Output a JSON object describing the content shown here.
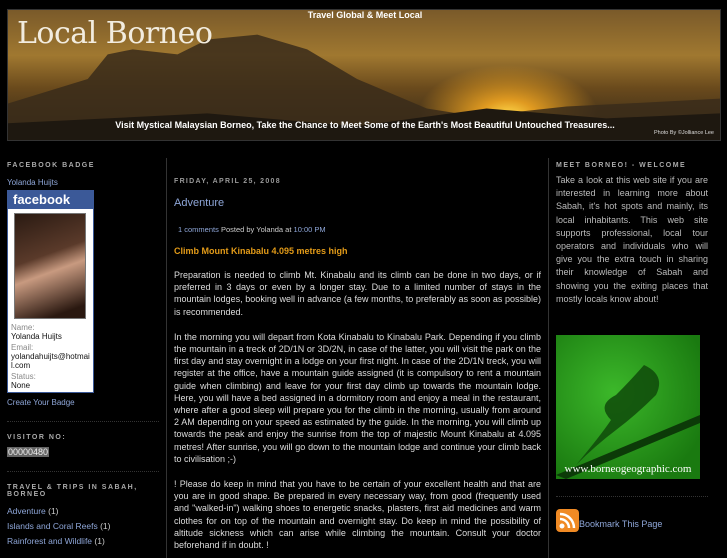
{
  "header": {
    "title": "Local Borneo",
    "tagline": "Travel Global & Meet Local",
    "description": "Visit Mystical Malaysian Borneo, Take the Chance to Meet Some of the Earth's Most Beautiful Untouched Treasures...",
    "photo_credit": "Photo By ©Jolliance Lee"
  },
  "left": {
    "facebook_heading": "Facebook Badge",
    "profile_link": "Yolanda Huijts",
    "badge": {
      "brand": "facebook",
      "name_label": "Name:",
      "name": "Yolanda Huijts",
      "email_label": "Email:",
      "email": "yolandahuijts@hotmail.com",
      "status_label": "Status:",
      "status": "None"
    },
    "create_badge": "Create Your Badge",
    "visitor_heading": "Visitor No:",
    "visitor_count": "00000480",
    "travel_heading": "Travel & Trips in Sabah, Borneo",
    "categories": [
      {
        "label": "Adventure",
        "count": "(1)"
      },
      {
        "label": "Islands and Coral Reefs",
        "count": "(1)"
      },
      {
        "label": "Rainforest and Wildlife",
        "count": "(1)"
      }
    ]
  },
  "post": {
    "date": "Friday, April 25, 2008",
    "title": "Adventure",
    "comments": "1 comments",
    "posted_by": "Posted by Yolanda at",
    "time": "10:00 PM",
    "subtitle": "Climb Mount Kinabalu 4.095 metres high",
    "paragraphs": [
      "Preparation is needed to climb Mt. Kinabalu and its climb can be done in two days, or if preferred in 3 days or even by a longer stay. Due to a limited number of stays in the mountain lodges, booking well in advance (a few months, to preferably as soon as possible) is recommended.",
      "In the morning you will depart from Kota Kinabalu to Kinabalu Park. Depending if you climb the mountain in a treck of 2D/1N or 3D/2N, in case of the latter, you will visit the park on the first day and stay overnight in a lodge on your first night. In case of the 2D/1N treck, you will register at the office, have a mountain guide assigned (it is compulsory to rent a mountain guide when climbing) and leave for your first day climb up towards the mountain lodge. Here, you will have a bed assigned in a dormitory room and enjoy a meal in the restaurant, where after a good sleep will prepare you for the climb in the morning, usually from around 2 AM depending on your speed as estimated by the guide. In the morning, you will climb up towards the peak and enjoy the sunrise from the top of majestic Mount Kinabalu at 4.095 metres! After sunrise, you will go down to the mountain lodge and continue your climb back to civilisation ;-)",
      "! Please do keep in mind that you have to be certain of your excellent health and that are you are in good shape. Be prepared in every necessary way, from good (frequently used and \"walked-in\") walking shoes to energetic snacks, plasters, first aid medicines and warm clothes for on top of the mountain and overnight stay. Do keep in mind the possibility of altitude sickness which can arise while climbing the mountain. Consult your doctor beforehand if in doubt. !"
    ]
  },
  "right": {
    "heading": "Meet Borneo! - Welcome",
    "welcome": "Take a look at this web site if you are interested in learning more about Sabah, it's hot spots and mainly, its local inhabitants. This web site supports professional, local tour operators and individuals who will give you the extra touch in sharing their knowledge of Sabah and showing you the exiting places that mostly locals know about!",
    "banner_url": "www.borneogeographic.com",
    "bookmark": "Bookmark This Page"
  }
}
